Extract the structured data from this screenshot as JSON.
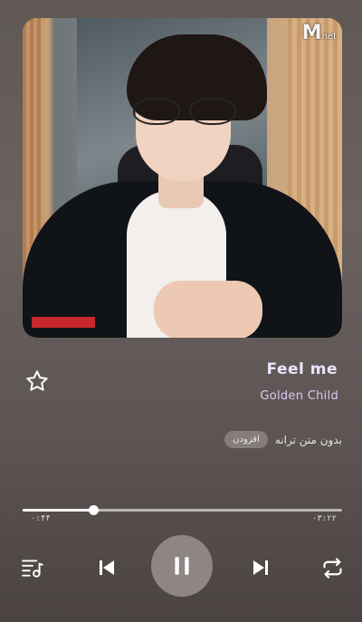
{
  "artwork": {
    "logo_text": "M",
    "logo_sub": "net"
  },
  "track": {
    "title": "Feel me",
    "artist": "Golden Child"
  },
  "lyrics": {
    "status_text": "بدون متن ترانه",
    "add_label": "افزودن"
  },
  "progress": {
    "elapsed": "۰:۴۴",
    "total": "۰۳:۲۲",
    "fraction": 0.22
  },
  "controls": {
    "queue_icon": "queue-music-icon",
    "previous_icon": "skip-previous-icon",
    "play_pause_icon": "pause-icon",
    "next_icon": "skip-next-icon",
    "repeat_icon": "repeat-icon",
    "favorite_icon": "star-outline-icon"
  },
  "colors": {
    "title": "#ece4ff",
    "artist": "#d9c9f4",
    "play_button": "#8e8684"
  }
}
